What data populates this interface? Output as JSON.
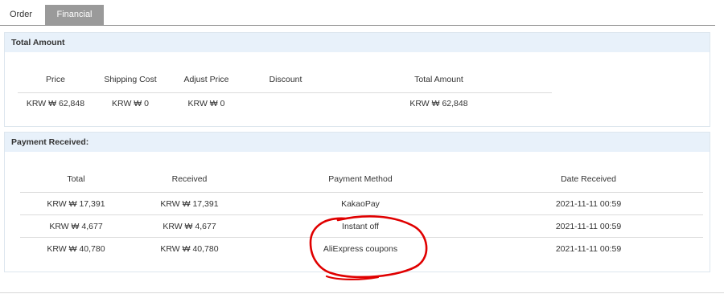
{
  "tabs": [
    {
      "label": "Order",
      "active": false
    },
    {
      "label": "Financial",
      "active": true
    }
  ],
  "total_amount": {
    "title": "Total Amount",
    "headers": [
      "Price",
      "Shipping Cost",
      "Adjust Price",
      "Discount",
      "Total Amount"
    ],
    "row": [
      "KRW ₩ 62,848",
      "KRW ₩ 0",
      "KRW ₩ 0",
      "",
      "KRW ₩ 62,848"
    ]
  },
  "payment_received": {
    "title": "Payment Received:",
    "headers": [
      "Total",
      "Received",
      "Payment Method",
      "Date Received"
    ],
    "rows": [
      [
        "KRW ₩ 17,391",
        "KRW ₩ 17,391",
        "KakaoPay",
        "2021-11-11 00:59"
      ],
      [
        "KRW ₩ 4,677",
        "KRW ₩ 4,677",
        "Instant off",
        "2021-11-11 00:59"
      ],
      [
        "KRW ₩ 40,780",
        "KRW ₩ 40,780",
        "AliExpress coupons",
        "2021-11-11 00:59"
      ]
    ]
  },
  "colors": {
    "tab_active_bg": "#9a9a9a",
    "panel_header_bg": "#e8f1fa",
    "annotation": "#e00000"
  },
  "annotation": {
    "shape": "hand-drawn circle",
    "color": "#e00000"
  }
}
